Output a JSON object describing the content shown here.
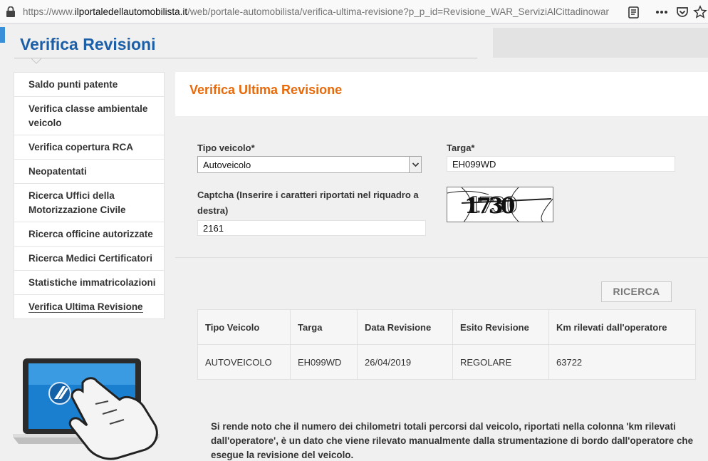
{
  "browser": {
    "url_prefix": "https://www.",
    "url_host": "ilportaledellautomobilista.it",
    "url_path": "/web/portale-automobilista/verifica-ultima-revisione?p_p_id=Revisione_WAR_ServiziAlCittadinowar"
  },
  "page": {
    "title": "Verifica Revisioni"
  },
  "sidebar": {
    "items": [
      {
        "label": "Saldo punti patente"
      },
      {
        "label": "Verifica classe ambientale veicolo"
      },
      {
        "label": "Verifica copertura RCA"
      },
      {
        "label": "Neopatentati"
      },
      {
        "label": "Ricerca Uffici della Motorizzazione Civile"
      },
      {
        "label": "Ricerca officine autorizzate"
      },
      {
        "label": "Ricerca Medici Certificatori"
      },
      {
        "label": "Statistiche immatricolazioni"
      },
      {
        "label": "Verifica Ultima Revisione"
      }
    ]
  },
  "main": {
    "title": "Verifica Ultima Revisione",
    "form": {
      "tipo_label": "Tipo veicolo*",
      "tipo_value": "Autoveicolo",
      "targa_label": "Targa*",
      "targa_value": "EH099WD",
      "captcha_label": "Captcha (Inserire i caratteri riportati nel riquadro a destra)",
      "captcha_value": "2161",
      "captcha_image_text": "1730"
    },
    "search_button": "RICERCA",
    "table": {
      "headers": [
        "Tipo Veicolo",
        "Targa",
        "Data Revisione",
        "Esito Revisione",
        "Km rilevati dall'operatore"
      ],
      "rows": [
        [
          "AUTOVEICOLO",
          "EH099WD",
          "26/04/2019",
          "REGOLARE",
          "63722"
        ]
      ]
    },
    "note": "Si rende noto che il numero dei chilometri totali percorsi dal veicolo, riportati nella colonna 'km rilevati dall'operatore', è un dato che viene rilevato manualmente dalla strumentazione di bordo dall'operatore che esegue la revisione del veicolo."
  },
  "colors": {
    "title_blue": "#1c5fa8",
    "accent_orange": "#e8690a"
  },
  "icons": [
    "lock-icon",
    "reader-view-icon",
    "more-icon",
    "pocket-icon",
    "star-icon",
    "dropdown-arrow-icon"
  ]
}
